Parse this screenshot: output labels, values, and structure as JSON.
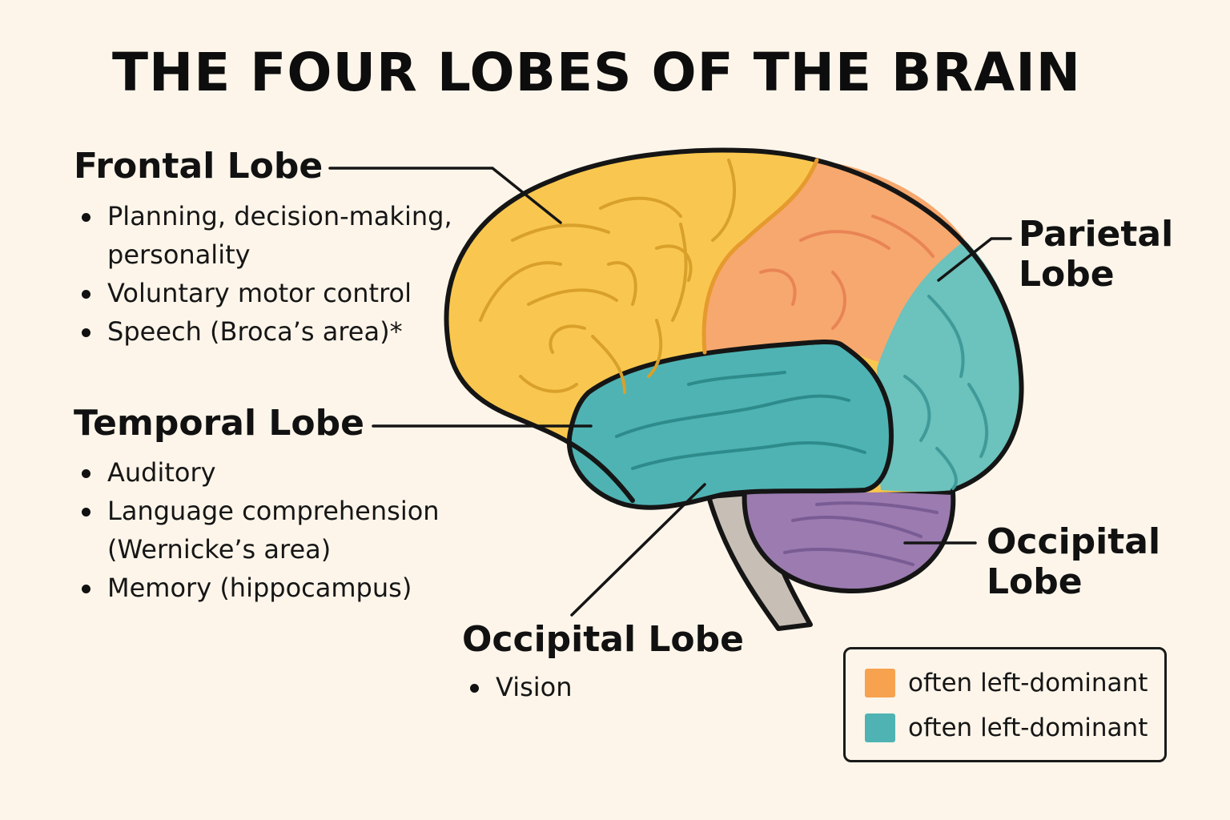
{
  "title": "THE FOUR LOBES OF THE BRAIN",
  "colors": {
    "frontal": "#f9c74f",
    "parietal": "#f7a86e",
    "temporal": "#4fb3b3",
    "occipital": "#9b7bb0",
    "stem": "#c7bfb5",
    "background": "#fdf5ea"
  },
  "frontal": {
    "heading": "Frontal Lobe",
    "bullets": [
      "Planning, decision-making, personality",
      "Voluntary motor control",
      "Speech (Broca’s area)*"
    ]
  },
  "temporal": {
    "heading": "Temporal Lobe",
    "bullets": [
      "Auditory",
      "Language comprehension (Wernicke’s area)",
      "Memory (hippocampus)"
    ]
  },
  "occipital_bottom": {
    "heading": "Occipital Lobe",
    "bullets": [
      "Vision"
    ]
  },
  "parietal_label": "Parietal Lobe",
  "occipital_right_label": "Occipital Lobe",
  "legend": [
    {
      "label": "often left-dominant",
      "color": "#f7a24f"
    },
    {
      "label": "often left-dominant",
      "color": "#4fb3b3"
    }
  ]
}
